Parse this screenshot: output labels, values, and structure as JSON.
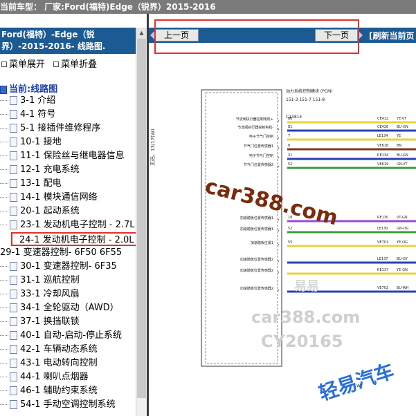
{
  "topbar": {
    "title": "当前车型： 厂家:Ford(福特)Edge（锐界）2015-2016"
  },
  "sidebar": {
    "header": "Ford(福特）-Edge（锐界）-2015-2016- 线路图.",
    "menu": {
      "expand": "菜单展开",
      "collapse": "菜单折叠"
    },
    "root": "当前:线路图",
    "items": [
      "3-1 介绍",
      "4-1 符号",
      "5-1 接插件维修程序",
      "10-1 接地",
      "11-1 保险丝与继电器信息",
      "12-1 充电系统",
      "13-1 配电",
      "14-1 模块通信网络",
      "20-1 起动系统",
      "23-1 发动机电子控制 - 2.7L",
      "24-1 发动机电子控制 - 2.0L",
      "29-1 变速器控制- 6F50 6F55",
      "30-1 变速器控制- 6F35",
      "31-1 巡航控制",
      "33-1 冷却风扇",
      "34-1 全轮驱动（AWD）",
      "37-1 换挡联锁",
      "40-1 自动-启动-停止系统",
      "42-1 车辆动态系统",
      "43-1 电动转向控制",
      "44-1 喇叭点烟器",
      "46-1 辅助约束系统",
      "54-1 手动空调控制系统"
    ]
  },
  "nav": {
    "prev": "上一页",
    "next": "下一页",
    "refresh": "[刷新当前页"
  },
  "diagram": {
    "module_title": "动力系统控制模块 (PCM)",
    "module_refs": "151-3  151-7  151-8",
    "connector": "C1381E",
    "side_label": "页码，13/17(W)",
    "signals": [
      {
        "label": "节流阀执行器控制电机+",
        "pin": "86",
        "circuit": "CE412",
        "color_code": "YE-VT",
        "wire": "#e8d23a"
      },
      {
        "label": "节流阀执行器控制电机-",
        "pin": "81",
        "circuit": "CE426",
        "color_code": "BU-GN",
        "wire": "#2a3fb0"
      },
      {
        "label": "电子节气门控制",
        "pin": "7",
        "circuit": "LE134",
        "color_code": "YE",
        "wire": "#e8d23a"
      },
      {
        "label": "节气门位置传感器1",
        "pin": "8",
        "circuit": "VE618",
        "color_code": "BN",
        "wire": "#7a3a1e"
      },
      {
        "label": "电子节气门控制",
        "pin": "31",
        "circuit": "RE134",
        "color_code": "BU-GN",
        "wire": "#2a3fb0"
      },
      {
        "label": "节气门位置传感器2",
        "pin": "52",
        "circuit": "VE619",
        "color_code": "GN-VT",
        "wire": "#3c9a3c"
      },
      {
        "label": "加速踏板位置传感器1",
        "pin": "18",
        "circuit": "RE130",
        "color_code": "VT-GN",
        "wire": "#9a4ad0"
      },
      {
        "label": "加速踏板位置传感器1",
        "pin": "52",
        "circuit": "LE130",
        "color_code": "GN-OG",
        "wire": "#3c9a3c"
      },
      {
        "label": "加速踏板位置1",
        "pin": "55",
        "circuit": "VE701",
        "color_code": "YE-OG",
        "wire": "#e8d23a"
      },
      {
        "label": "加速踏板位置传感器2",
        "pin": "",
        "circuit": "LE137",
        "color_code": "BU-GY",
        "wire": "#2a3fb0"
      },
      {
        "label": "加速踏板位置传感器2",
        "pin": "",
        "circuit": "RE137",
        "color_code": "YE-GN",
        "wire": "#e8d23a"
      },
      {
        "label": "加速踏板位置传感器2",
        "pin": "",
        "circuit": "VE702",
        "color_code": "BU-WH",
        "wire": "#2a3fb0"
      }
    ],
    "watermarks": [
      "car388.com",
      "car388.com",
      "CY20165",
      "易易",
      "轻易汽车"
    ]
  }
}
